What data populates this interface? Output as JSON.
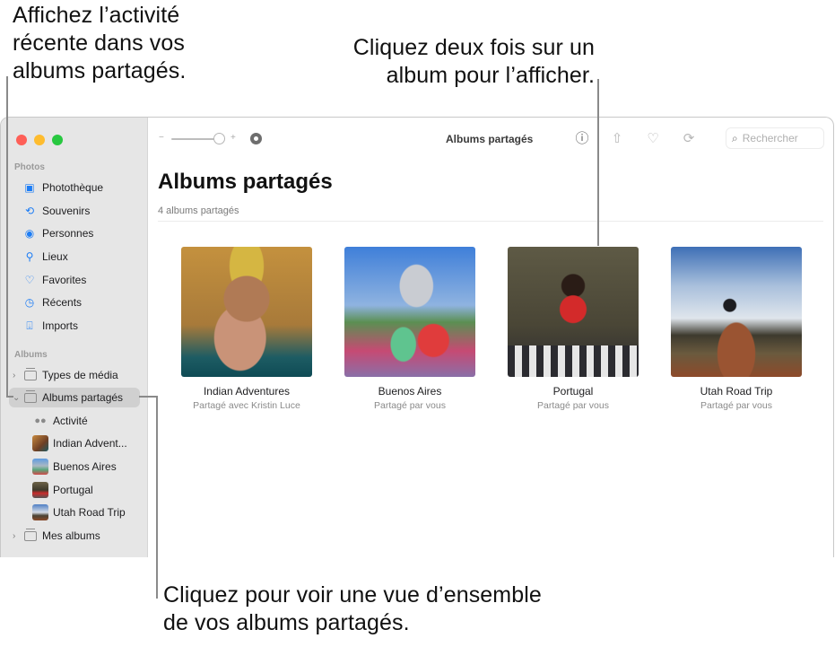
{
  "callouts": {
    "activity": "Affichez l’activité\nrécente dans vos\nalbums partagés.",
    "double_click": "Cliquez deux fois sur un\nalbum pour l’afficher.",
    "overview": "Cliquez pour voir une vue d’ensemble\nde vos albums partagés."
  },
  "sidebar": {
    "section_photos": "Photos",
    "library_items": [
      {
        "label": "Photothèque",
        "icon": "photo-library-icon"
      },
      {
        "label": "Souvenirs",
        "icon": "memories-icon"
      },
      {
        "label": "Personnes",
        "icon": "people-icon"
      },
      {
        "label": "Lieux",
        "icon": "places-icon"
      },
      {
        "label": "Favorites",
        "icon": "heart-icon"
      },
      {
        "label": "Récents",
        "icon": "clock-icon"
      },
      {
        "label": "Imports",
        "icon": "import-icon"
      }
    ],
    "section_albums": "Albums",
    "media_types": "Types de média",
    "shared_albums": "Albums partagés",
    "shared_children": [
      {
        "label": "Activité"
      },
      {
        "label": "Indian Advent..."
      },
      {
        "label": "Buenos Aires"
      },
      {
        "label": "Portugal"
      },
      {
        "label": "Utah Road Trip"
      }
    ],
    "my_albums": "Mes albums"
  },
  "toolbar": {
    "title": "Albums partagés",
    "search_placeholder": "Rechercher",
    "zoom_minus": "−",
    "zoom_plus": "+",
    "slider_value_fraction": 0.95
  },
  "main": {
    "title": "Albums partagés",
    "count": "4 albums partagés",
    "albums": [
      {
        "name": "Indian Adventures",
        "subtitle": "Partagé avec Kristin Luce"
      },
      {
        "name": "Buenos Aires",
        "subtitle": "Partagé par vous"
      },
      {
        "name": "Portugal",
        "subtitle": "Partagé par vous"
      },
      {
        "name": "Utah Road Trip",
        "subtitle": "Partagé par vous"
      }
    ]
  },
  "colors": {
    "accent": "#1d7df5",
    "close": "#fe5f57",
    "minimize": "#febc2e",
    "zoom": "#28c840"
  }
}
